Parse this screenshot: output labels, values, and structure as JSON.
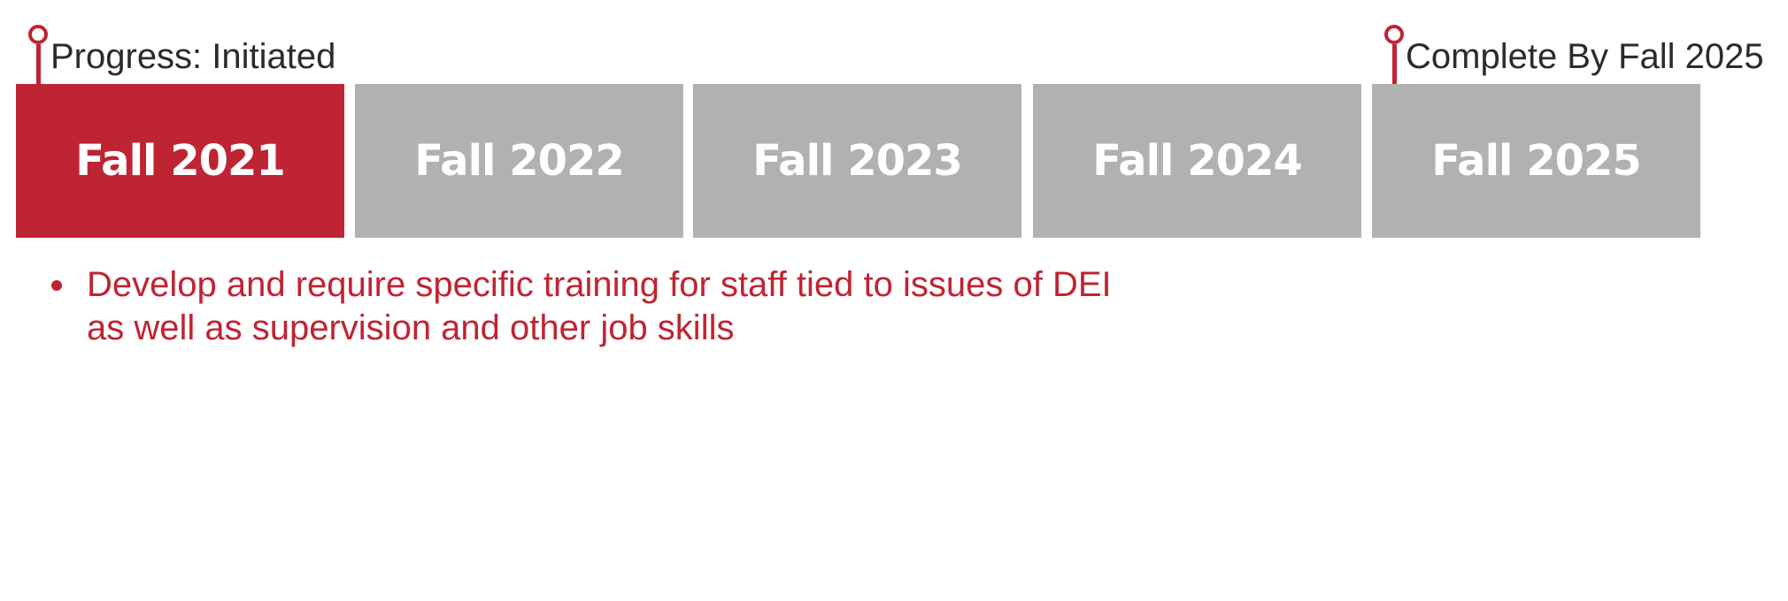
{
  "progress_marker": {
    "label": "Progress: Initiated"
  },
  "completion_marker": {
    "label": "Complete By Fall 2025"
  },
  "timeline": {
    "stages": [
      {
        "label": "Fall 2021",
        "active": true
      },
      {
        "label": "Fall 2022",
        "active": false
      },
      {
        "label": "Fall 2023",
        "active": false
      },
      {
        "label": "Fall 2024",
        "active": false
      },
      {
        "label": "Fall 2025",
        "active": false
      }
    ]
  },
  "goals": [
    {
      "line1": "Develop and require specific training for staff tied to issues of DEI",
      "line2": "as well as supervision and other job skills"
    }
  ],
  "colors": {
    "accent": "#bf2433",
    "inactive": "#b1b1b1",
    "text": "#2b2b2b"
  }
}
